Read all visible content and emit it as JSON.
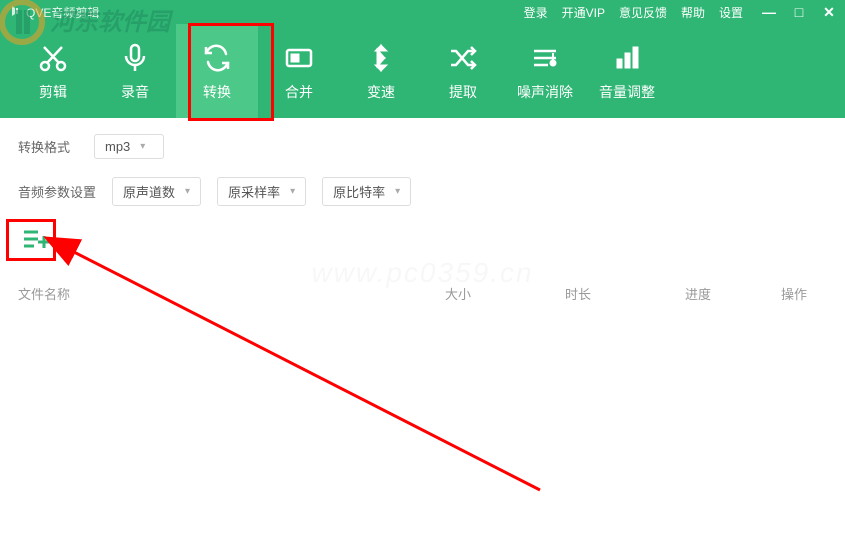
{
  "app": {
    "title": "QVE音频剪辑"
  },
  "titlebar": {
    "login": "登录",
    "vip": "开通VIP",
    "feedback": "意见反馈",
    "help": "帮助",
    "settings": "设置"
  },
  "tools": {
    "edit": "剪辑",
    "record": "录音",
    "convert": "转换",
    "merge": "合并",
    "speed": "变速",
    "extract": "提取",
    "denoise": "噪声消除",
    "volume": "音量调整"
  },
  "form": {
    "format_label": "转换格式",
    "format_value": "mp3",
    "audio_params_label": "音频参数设置",
    "channels": "原声道数",
    "samplerate": "原采样率",
    "bitrate": "原比特率"
  },
  "table": {
    "filename": "文件名称",
    "size": "大小",
    "duration": "时长",
    "progress": "进度",
    "action": "操作"
  },
  "watermark": {
    "site": "河东软件园",
    "url": "www.pc0359.cn"
  }
}
